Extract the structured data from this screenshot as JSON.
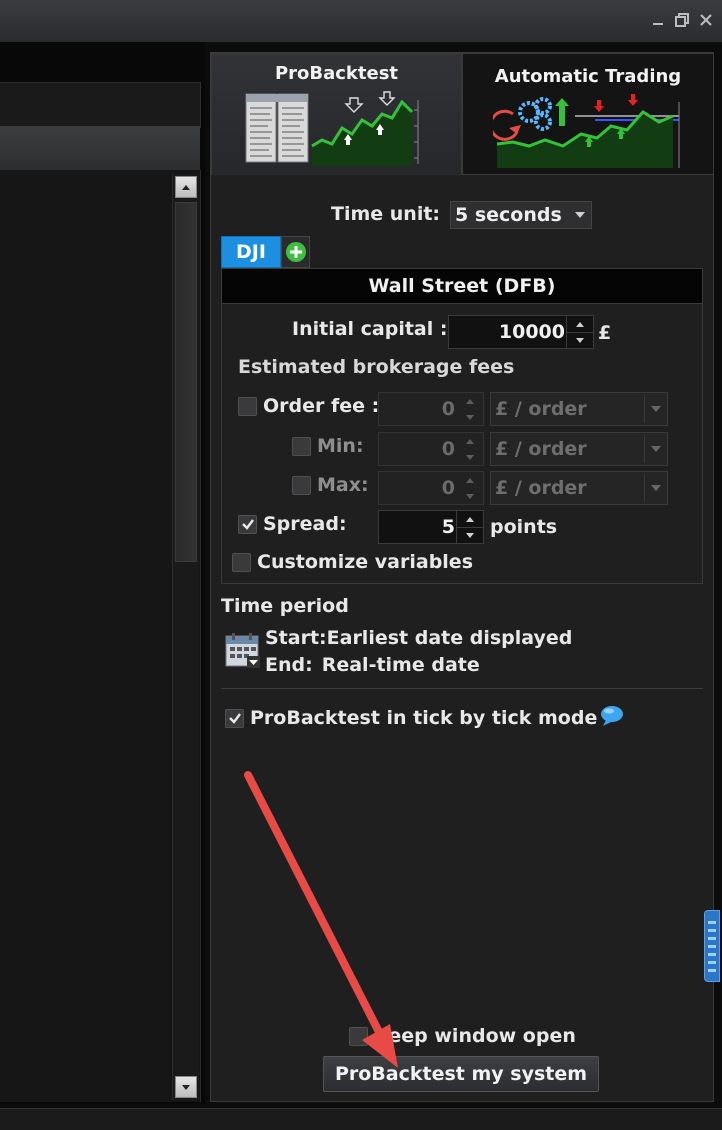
{
  "tabs": {
    "probacktest": "ProBacktest",
    "automatic_trading": "Automatic Trading"
  },
  "time_unit": {
    "label": "Time unit:",
    "value": "5 seconds"
  },
  "instrument": {
    "code": "DJI",
    "name": "Wall Street (DFB)"
  },
  "capital": {
    "label": "Initial capital :",
    "value": "10000",
    "currency": "£"
  },
  "fees": {
    "heading": "Estimated brokerage fees",
    "order_fee": {
      "label": "Order fee :",
      "value": "0",
      "unit": "£ / order",
      "checked": false
    },
    "min": {
      "label": "Min:",
      "value": "0",
      "unit": "£ / order",
      "checked": false
    },
    "max": {
      "label": "Max:",
      "value": "0",
      "unit": "£ / order",
      "checked": false
    },
    "spread": {
      "label": "Spread:",
      "value": "5",
      "unit": "points",
      "checked": true
    }
  },
  "customize_variables": {
    "label": "Customize variables",
    "checked": false
  },
  "time_period": {
    "heading": "Time period",
    "start": "Start:Earliest date displayed",
    "end_label": "End:",
    "end_value": "Real-time date"
  },
  "tick_mode": {
    "label": "ProBacktest in tick by tick mode",
    "checked": true
  },
  "keep_open": {
    "label": "Keep window open",
    "checked": false
  },
  "run_button": "ProBacktest my system",
  "colors": {
    "accent_blue": "#1d8fe0",
    "annotation_arrow": "#e84a45",
    "chart_green": "#35c23a"
  }
}
